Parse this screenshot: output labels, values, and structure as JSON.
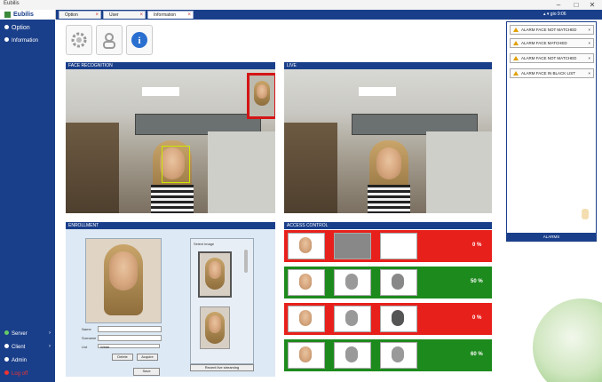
{
  "window": {
    "title": "Eubilis",
    "min": "–",
    "max": "□",
    "close": "✕"
  },
  "header": {
    "brand": "Eubilis",
    "tabs": [
      {
        "label": "Option"
      },
      {
        "label": "User"
      },
      {
        "label": "Information"
      }
    ],
    "right_text": "▴ ▾ gio 9:06"
  },
  "sidebar": {
    "top_items": [
      {
        "label": "Option"
      },
      {
        "label": "Information"
      }
    ],
    "bottom_items": [
      {
        "label": "Server"
      },
      {
        "label": "Client"
      },
      {
        "label": "Admin"
      },
      {
        "label": "Log off"
      }
    ]
  },
  "panels": {
    "face_recognition": "FACE RECOGNITION",
    "live": "LIVE",
    "enrollment": "ENROLLMENT",
    "access_control": "ACCESS CONTROL"
  },
  "enrollment": {
    "select_image_label": "Select image",
    "name_label": "Name",
    "surname_label": "Surname",
    "list_label": "List",
    "list_value": "White",
    "btn_a": "Delete",
    "btn_b": "Acquire",
    "btn_save": "Save",
    "btn_recent": "Recent live streaming"
  },
  "access_control": {
    "rows": [
      {
        "pct": "0 %",
        "status_color": "#e8201c"
      },
      {
        "pct": "50 %",
        "status_color": "#1d8a1d"
      },
      {
        "pct": "0 %",
        "status_color": "#e8201c"
      },
      {
        "pct": "60 %",
        "status_color": "#1d8a1d"
      }
    ]
  },
  "alarms": {
    "items": [
      {
        "label": "ALARM FACE NOT MATCHED"
      },
      {
        "label": "ALARM FACE MATCHED"
      },
      {
        "label": "ALARM FACE NOT MATCHED"
      },
      {
        "label": "ALARM FACE IN BLACK LIST"
      }
    ],
    "footer": "ALARMS"
  },
  "colors": {
    "accent": "#1a3f8a",
    "alarm_red": "#e8201c",
    "ok_green": "#1d8a1d"
  },
  "icons": {
    "settings": "gear-icon",
    "user": "user-icon",
    "info": "info-icon"
  }
}
